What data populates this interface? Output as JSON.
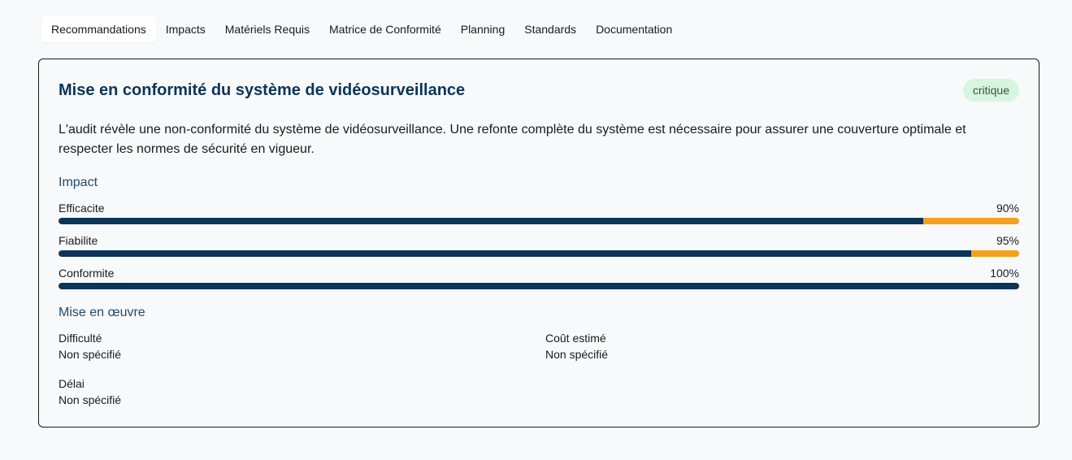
{
  "tabs": [
    {
      "label": "Recommandations",
      "active": true
    },
    {
      "label": "Impacts",
      "active": false
    },
    {
      "label": "Matériels Requis",
      "active": false
    },
    {
      "label": "Matrice de Conformité",
      "active": false
    },
    {
      "label": "Planning",
      "active": false
    },
    {
      "label": "Standards",
      "active": false
    },
    {
      "label": "Documentation",
      "active": false
    }
  ],
  "card": {
    "title": "Mise en conformité du système de vidéosurveillance",
    "badge": "critique",
    "description": "L'audit révèle une non-conformité du système de vidéosurveillance. Une refonte complète du système est nécessaire pour assurer une couverture optimale et respecter les normes de sécurité en vigueur."
  },
  "impact": {
    "title": "Impact",
    "metrics": [
      {
        "label": "Efficacite",
        "value_text": "90%",
        "percent": 90
      },
      {
        "label": "Fiabilite",
        "value_text": "95%",
        "percent": 95
      },
      {
        "label": "Conformite",
        "value_text": "100%",
        "percent": 100
      }
    ]
  },
  "implementation": {
    "title": "Mise en œuvre",
    "difficulty_label": "Difficulté",
    "difficulty_value": "Non spécifié",
    "cost_label": "Coût estimé",
    "cost_value": "Non spécifié",
    "delay_label": "Délai",
    "delay_value": "Non spécifié"
  },
  "colors": {
    "bar_fill": "#0b3558",
    "bar_track": "#f5a01c",
    "badge_bg": "#d7f5df"
  }
}
